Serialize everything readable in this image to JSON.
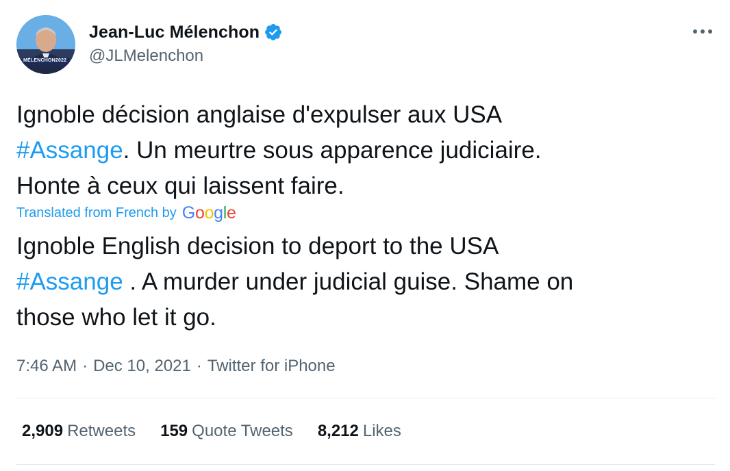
{
  "author": {
    "name": "Jean-Luc Mélenchon",
    "handle": "@JLMelenchon",
    "verified": true,
    "avatar_badge": "MÉLENCHON2022"
  },
  "tweet": {
    "original": {
      "line1": "Ignoble décision anglaise d'expulser aux USA",
      "hashtag": "#Assange",
      "line2_rest": ". Un meurtre sous apparence judiciaire.",
      "line3": "Honte à ceux qui laissent faire."
    },
    "translated_label": "Translated from French by",
    "translator": "Google",
    "translation": {
      "line1": "Ignoble English decision to deport to the USA",
      "hashtag": "#Assange",
      "line2_rest": " . A murder under judicial guise. Shame on",
      "line3": "those who let it go."
    }
  },
  "meta": {
    "time": "7:46 AM",
    "separator": "·",
    "date": "Dec 10, 2021",
    "source": "Twitter for iPhone"
  },
  "stats": {
    "retweets": {
      "count": "2,909",
      "label": "Retweets"
    },
    "quotes": {
      "count": "159",
      "label": "Quote Tweets"
    },
    "likes": {
      "count": "8,212",
      "label": "Likes"
    }
  },
  "icons": {
    "verified": "verified-badge-icon",
    "more": "more-options-icon"
  },
  "colors": {
    "link": "#1d9bf0",
    "text": "#0f1419",
    "secondary": "#536471",
    "divider": "#e6e9eb"
  }
}
